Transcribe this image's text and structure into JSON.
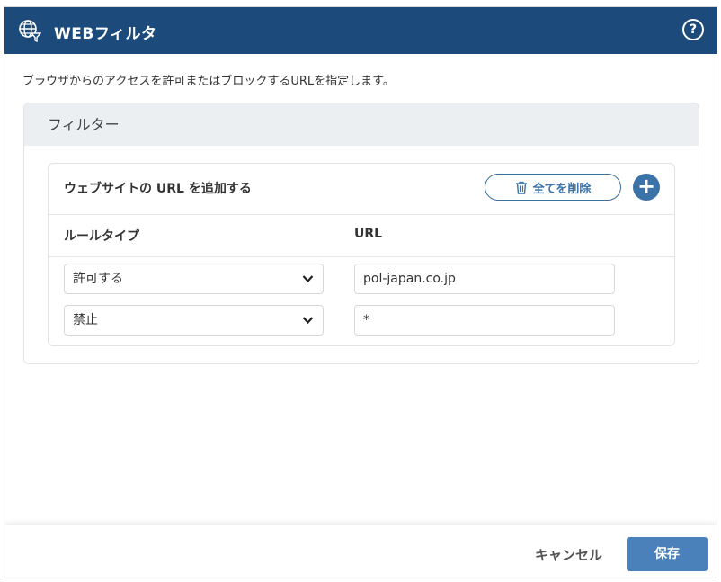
{
  "header": {
    "title": "WEBフィルタ",
    "icon": "globe-filter-icon",
    "help_icon": "help-icon",
    "help_glyph": "?"
  },
  "description": "ブラウザからのアクセスを許可またはブロックするURLを指定します。",
  "filter_panel": {
    "title": "フィルター",
    "card": {
      "title": "ウェブサイトの URL を追加する",
      "delete_all_label": "全てを削除",
      "add_glyph": "+",
      "columns": {
        "rule_type": "ルールタイプ",
        "url": "URL"
      },
      "rows": [
        {
          "rule_type": "許可する",
          "url": "pol-japan.co.jp"
        },
        {
          "rule_type": "禁止",
          "url": "*"
        }
      ]
    }
  },
  "footer": {
    "cancel_label": "キャンセル",
    "save_label": "保存"
  },
  "colors": {
    "header_bg": "#1c4a7a",
    "accent": "#3b72a8",
    "save_bg": "#4b81bb",
    "panel_head_bg": "#eceff1"
  }
}
